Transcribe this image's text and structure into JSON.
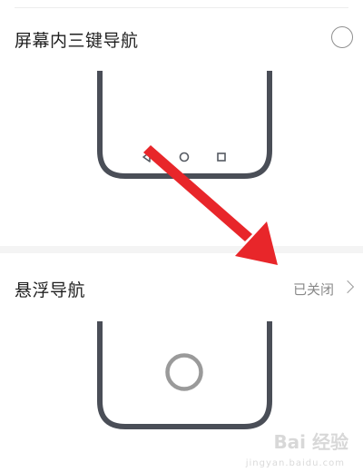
{
  "sections": [
    {
      "title": "屏幕内三键导航",
      "control": "radio",
      "selected": false,
      "nav_icons": [
        "back-triangle-icon",
        "home-circle-icon",
        "recents-square-icon"
      ]
    },
    {
      "title": "悬浮导航",
      "control": "status-link",
      "status": "已关闭",
      "preview_icon": "floating-nav-ring-icon"
    }
  ],
  "watermark": {
    "text": "Bai 经验",
    "subtext": "jingyan.baidu.com"
  },
  "colors": {
    "phone_frame": "#4a4e57",
    "arrow": "#e8262a",
    "radio_border": "#8f8f8f",
    "status_text": "#888888"
  }
}
